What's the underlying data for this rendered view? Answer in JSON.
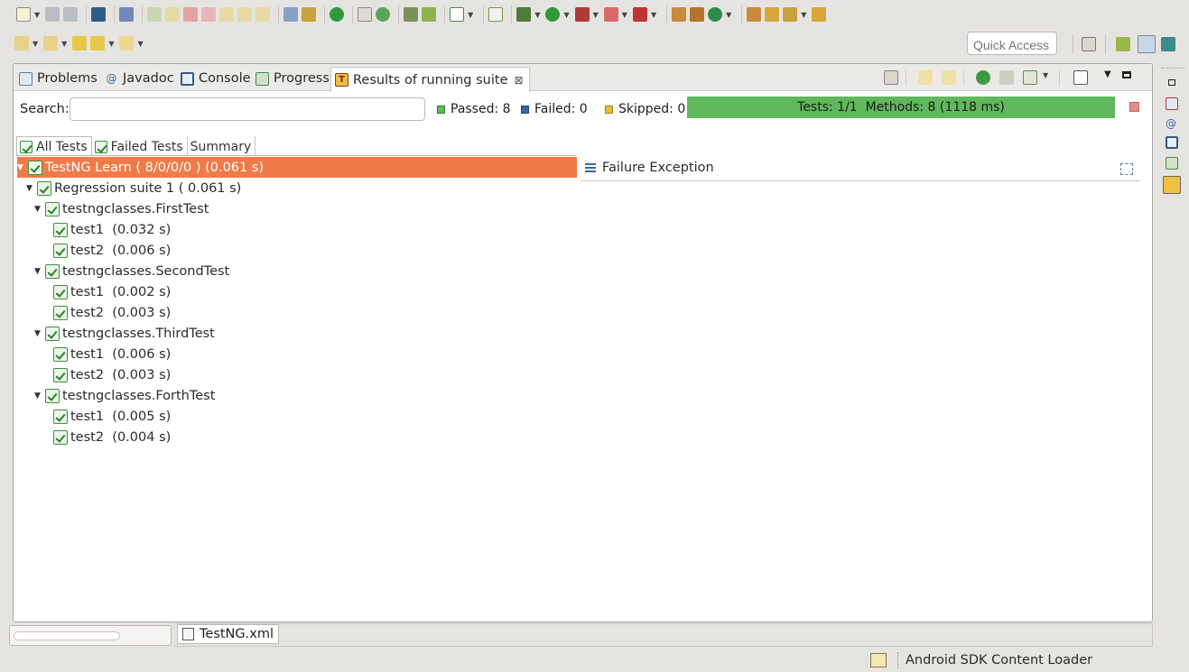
{
  "colors": {
    "progress_green": "#5fb85c",
    "selection_orange": "#f07b48",
    "passed_green": "#3f8f3f",
    "failed_blue": "#3b63a6",
    "skipped_yellow": "#e6c23a"
  },
  "toolbar": {
    "quick_access_placeholder": "Quick Access"
  },
  "view_tabs": [
    {
      "label": "Problems",
      "icon": "problems-icon"
    },
    {
      "label": "Javadoc",
      "icon": "javadoc-icon"
    },
    {
      "label": "Console",
      "icon": "console-icon"
    },
    {
      "label": "Progress",
      "icon": "progress-icon"
    },
    {
      "label": "Results of running suite",
      "icon": "testng-icon",
      "active": true
    }
  ],
  "search": {
    "label": "Search:",
    "value": ""
  },
  "stats": {
    "passed": "Passed: 8",
    "failed": "Failed: 0",
    "skipped": "Skipped: 0"
  },
  "progress": {
    "text": "Tests: 1/1  Methods: 8 (1118 ms)",
    "fraction": 1.0
  },
  "sub_tabs": [
    {
      "label": "All Tests",
      "active": true
    },
    {
      "label": "Failed Tests"
    },
    {
      "label": "Summary"
    }
  ],
  "tree": [
    {
      "label": "TestNG Learn ( 8/0/0/0 ) (0.061 s)",
      "level": 0,
      "expanded": true,
      "selected": true
    },
    {
      "label": "Regression suite 1 ( 0.061 s)",
      "level": 1,
      "expanded": true
    },
    {
      "label": "testngclasses.FirstTest",
      "level": 2,
      "expanded": true
    },
    {
      "label": "test1  (0.032 s)",
      "level": 3
    },
    {
      "label": "test2  (0.006 s)",
      "level": 3
    },
    {
      "label": "testngclasses.SecondTest",
      "level": 2,
      "expanded": true
    },
    {
      "label": "test1  (0.002 s)",
      "level": 3
    },
    {
      "label": "test2  (0.003 s)",
      "level": 3
    },
    {
      "label": "testngclasses.ThirdTest",
      "level": 2,
      "expanded": true
    },
    {
      "label": "test1  (0.006 s)",
      "level": 3
    },
    {
      "label": "test2  (0.003 s)",
      "level": 3
    },
    {
      "label": "testngclasses.ForthTest",
      "level": 2,
      "expanded": true
    },
    {
      "label": "test1  (0.005 s)",
      "level": 3
    },
    {
      "label": "test2  (0.004 s)",
      "level": 3
    }
  ],
  "failure_panel": {
    "title": "Failure Exception"
  },
  "editor_tab": {
    "label": "TestNG.xml"
  },
  "status_bar": {
    "text": "Android SDK Content Loader"
  }
}
